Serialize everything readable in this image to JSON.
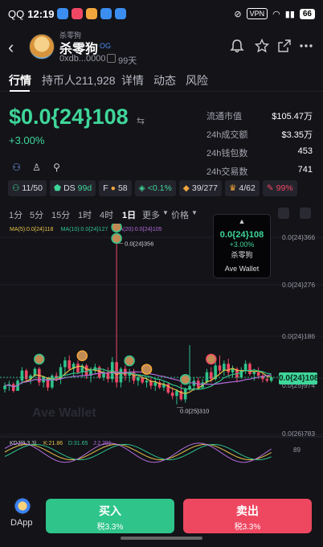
{
  "status_bar": {
    "carrier": "QQ",
    "time": "12:19",
    "vpn": "VPN",
    "battery": "66"
  },
  "header": {
    "back_icon": "chevron-left-icon",
    "token_small_name": "杀零狗",
    "token_name": "杀零狗",
    "badge": "OG",
    "address": "0xdb...0000",
    "age": "99天",
    "icons": [
      "bell-icon",
      "star-icon",
      "share-icon",
      "more-icon"
    ]
  },
  "tabs": [
    {
      "label": "行情",
      "active": true
    },
    {
      "label": "持币人211,928",
      "active": false
    },
    {
      "label": "详情",
      "active": false
    },
    {
      "label": "动态",
      "active": false
    },
    {
      "label": "风险",
      "active": false
    }
  ],
  "price": {
    "value": "$0.0{24}108",
    "change": "+3.00%"
  },
  "stats": [
    {
      "label": "流通市值",
      "value": "$105.47万"
    },
    {
      "label": "24h成交额",
      "value": "$3.35万"
    },
    {
      "label": "24h钱包数",
      "value": "453"
    },
    {
      "label": "24h交易数",
      "value": "741"
    }
  ],
  "chips": [
    {
      "icon": "holders-icon",
      "text": "11/50",
      "color": "green"
    },
    {
      "icon": "shield-icon",
      "text": "DS",
      "extra": "99d",
      "color": "green"
    },
    {
      "icon": "f-icon",
      "text": "F",
      "extra": "58",
      "color": "orange"
    },
    {
      "icon": "layers-icon",
      "text": "<0.1%",
      "color": "green"
    },
    {
      "icon": "bag-icon",
      "text": "39/277",
      "color": "orange"
    },
    {
      "icon": "trophy-icon",
      "text": "4/62",
      "color": "orange"
    },
    {
      "icon": "dev-icon",
      "text": "99%",
      "color": "red"
    }
  ],
  "timeframes": [
    {
      "label": "1分",
      "active": false
    },
    {
      "label": "5分",
      "active": false
    },
    {
      "label": "15分",
      "active": false
    },
    {
      "label": "1时",
      "active": false
    },
    {
      "label": "4时",
      "active": false
    },
    {
      "label": "1日",
      "active": true
    },
    {
      "label": "更多",
      "active": false
    },
    {
      "label": "价格",
      "active": false
    }
  ],
  "tooltip": {
    "price": "0.0{24}108",
    "change": "+3.00%",
    "name": "杀零狗",
    "brand": "Ave Wallet"
  },
  "buttons": {
    "dapp": "DApp",
    "buy": "买入",
    "buy_tax": "税3.3%",
    "sell": "卖出",
    "sell_tax": "税3.3%"
  },
  "chart_data": {
    "type": "candlestick",
    "price_axis_labels": [
      "0.0{24}366",
      "0.0{24}276",
      "0.0{24}186",
      "0.0{24}108",
      "0.0{25}974",
      "0.0{26}783"
    ],
    "ma_legend": [
      {
        "text": "MA(5):0.0{24}118",
        "color": "#e6c34b"
      },
      {
        "text": "MA(10):0.0{24}127",
        "color": "#2fc28a"
      },
      {
        "text": "MA(20):0.0{24}105",
        "color": "#b26ad8"
      }
    ],
    "annotations": {
      "high": "0.0{24}356",
      "low": "0.0{25}310"
    },
    "current_price": "0.0{24}108",
    "watermark": "Ave Wallet",
    "candles": [
      [
        21,
        25,
        19,
        23
      ],
      [
        23,
        26,
        20,
        24
      ],
      [
        24,
        25,
        19,
        20
      ],
      [
        20,
        27,
        20,
        26
      ],
      [
        26,
        34,
        24,
        32
      ],
      [
        32,
        33,
        26,
        27
      ],
      [
        27,
        30,
        24,
        29
      ],
      [
        29,
        34,
        28,
        33
      ],
      [
        33,
        34,
        23,
        25
      ],
      [
        25,
        29,
        22,
        28
      ],
      [
        28,
        27,
        20,
        22
      ],
      [
        22,
        30,
        21,
        29
      ],
      [
        29,
        31,
        26,
        27
      ],
      [
        27,
        36,
        24,
        34
      ],
      [
        34,
        40,
        30,
        38
      ],
      [
        38,
        41,
        32,
        33
      ],
      [
        33,
        37,
        28,
        36
      ],
      [
        36,
        38,
        30,
        31
      ],
      [
        31,
        36,
        28,
        35
      ],
      [
        35,
        36,
        27,
        29
      ],
      [
        29,
        34,
        25,
        32
      ],
      [
        32,
        36,
        30,
        34
      ],
      [
        34,
        35,
        27,
        28
      ],
      [
        28,
        33,
        26,
        31
      ],
      [
        31,
        34,
        25,
        27
      ],
      [
        27,
        40,
        25,
        37
      ],
      [
        37,
        112,
        22,
        25
      ],
      [
        25,
        34,
        22,
        33
      ],
      [
        33,
        35,
        26,
        29
      ],
      [
        29,
        33,
        25,
        31
      ],
      [
        31,
        33,
        24,
        26
      ],
      [
        26,
        29,
        23,
        28
      ],
      [
        28,
        29,
        24,
        25
      ],
      [
        25,
        28,
        22,
        26
      ],
      [
        26,
        28,
        21,
        23
      ],
      [
        23,
        27,
        20,
        25
      ],
      [
        25,
        27,
        21,
        22
      ],
      [
        22,
        26,
        20,
        24
      ],
      [
        24,
        25,
        18,
        19
      ],
      [
        19,
        22,
        15,
        17
      ],
      [
        17,
        21,
        12,
        20
      ],
      [
        20,
        24,
        14,
        15
      ],
      [
        15,
        22,
        13,
        21
      ],
      [
        21,
        47,
        20,
        23
      ],
      [
        23,
        28,
        20,
        26
      ],
      [
        26,
        28,
        21,
        22
      ],
      [
        22,
        27,
        21,
        25
      ],
      [
        25,
        33,
        24,
        31
      ],
      [
        31,
        34,
        25,
        27
      ],
      [
        27,
        37,
        26,
        35
      ],
      [
        35,
        41,
        30,
        32
      ],
      [
        32,
        38,
        29,
        36
      ],
      [
        36,
        39,
        29,
        31
      ],
      [
        31,
        35,
        28,
        33
      ],
      [
        33,
        34,
        25,
        28
      ],
      [
        28,
        34,
        27,
        32
      ],
      [
        32,
        38,
        30,
        36
      ],
      [
        36,
        37,
        29,
        30
      ],
      [
        30,
        33,
        26,
        31
      ],
      [
        31,
        34,
        27,
        29
      ],
      [
        29,
        30,
        25,
        27
      ],
      [
        27,
        29,
        25,
        26
      ],
      [
        26,
        29,
        25,
        28
      ]
    ],
    "kdj_legend": [
      {
        "text": "KDJ(9,3,3)",
        "color": "#cfcfd6"
      },
      {
        "text": "K:21.86",
        "color": "#e6c34b"
      },
      {
        "text": "D:31.65",
        "color": "#2fc28a"
      },
      {
        "text": "J:2.291",
        "color": "#b26ad8"
      }
    ],
    "kdj_axis_label": "89"
  }
}
